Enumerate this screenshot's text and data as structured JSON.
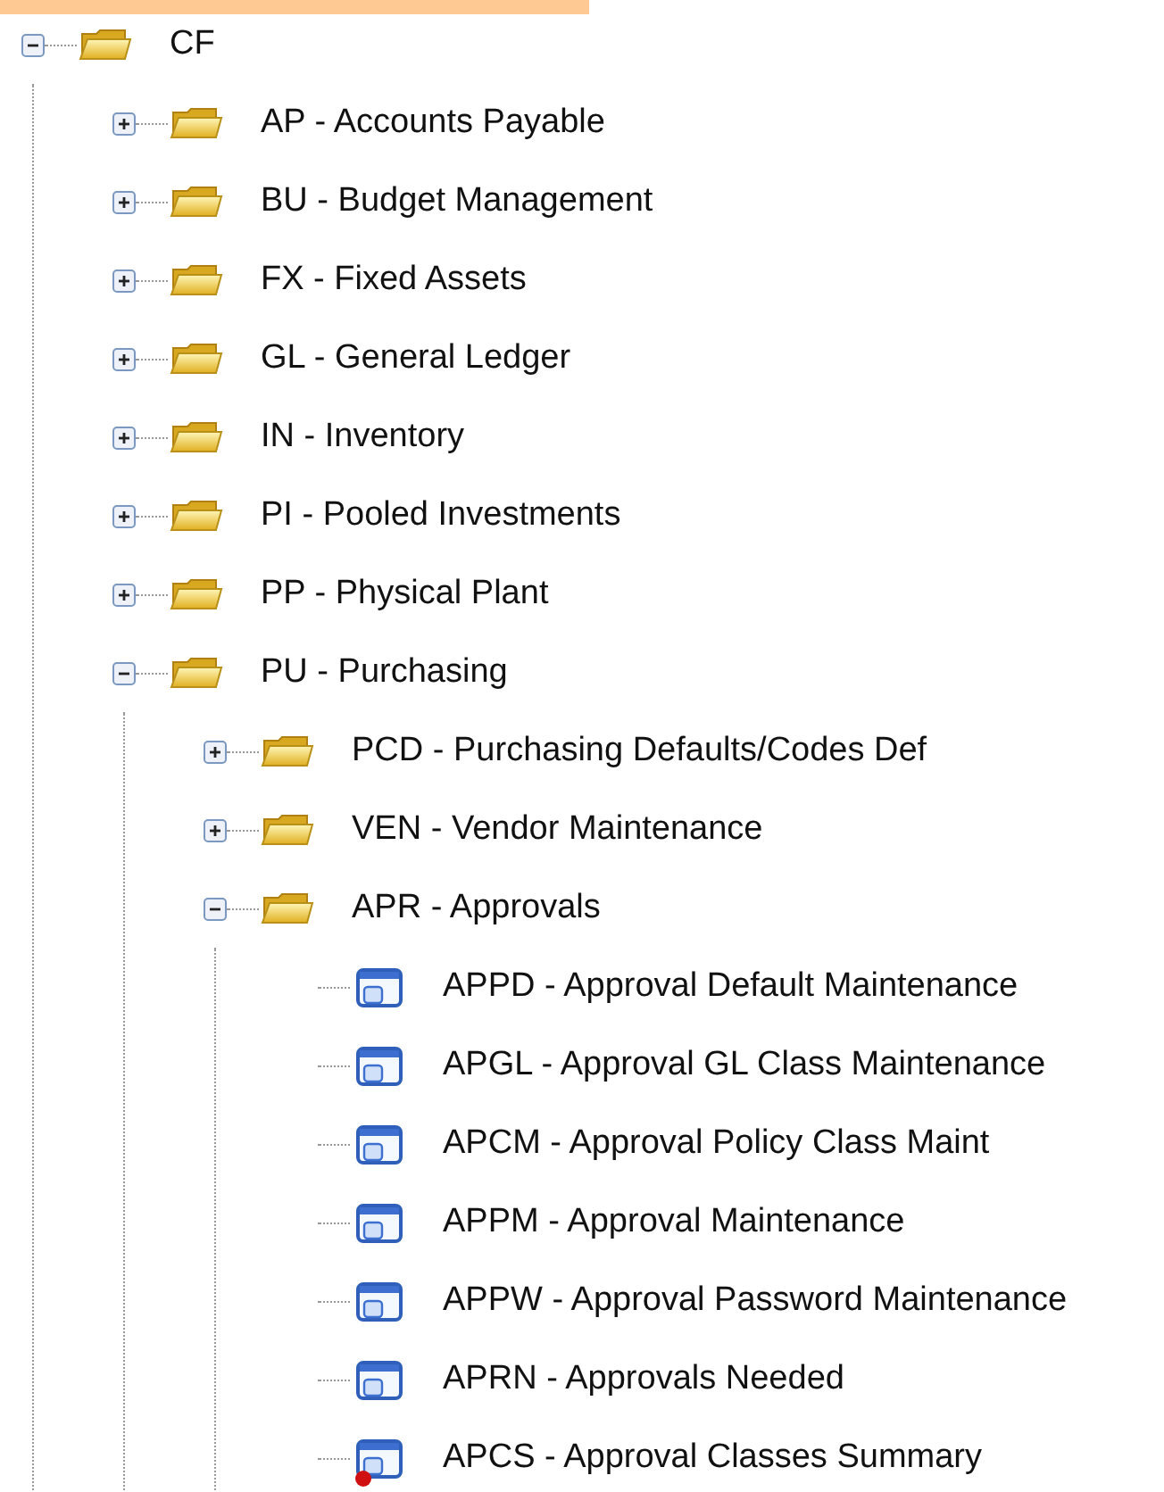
{
  "tree": [
    {
      "kind": "folder",
      "label": "CF",
      "expanded": true,
      "children": [
        {
          "kind": "folder",
          "label": "AP - Accounts Payable",
          "expanded": false
        },
        {
          "kind": "folder",
          "label": "BU - Budget Management",
          "expanded": false
        },
        {
          "kind": "folder",
          "label": "FX - Fixed Assets",
          "expanded": false
        },
        {
          "kind": "folder",
          "label": "GL - General Ledger",
          "expanded": false
        },
        {
          "kind": "folder",
          "label": "IN - Inventory",
          "expanded": false
        },
        {
          "kind": "folder",
          "label": "PI - Pooled Investments",
          "expanded": false
        },
        {
          "kind": "folder",
          "label": "PP - Physical Plant",
          "expanded": false
        },
        {
          "kind": "folder",
          "label": "PU - Purchasing",
          "expanded": true,
          "children": [
            {
              "kind": "folder",
              "label": "PCD - Purchasing Defaults/Codes Def",
              "expanded": false
            },
            {
              "kind": "folder",
              "label": "VEN - Vendor Maintenance",
              "expanded": false
            },
            {
              "kind": "folder",
              "label": "APR - Approvals",
              "expanded": true,
              "children": [
                {
                  "kind": "screen",
                  "label": "APPD - Approval Default Maintenance",
                  "alert": false
                },
                {
                  "kind": "screen",
                  "label": "APGL - Approval GL Class Maintenance",
                  "alert": false
                },
                {
                  "kind": "screen",
                  "label": "APCM - Approval Policy Class Maint",
                  "alert": false
                },
                {
                  "kind": "screen",
                  "label": "APPM - Approval Maintenance",
                  "alert": false
                },
                {
                  "kind": "screen",
                  "label": "APPW - Approval Password Maintenance",
                  "alert": false
                },
                {
                  "kind": "screen",
                  "label": "APRN - Approvals Needed",
                  "alert": false
                },
                {
                  "kind": "screen",
                  "label": "APCS - Approval Classes Summary",
                  "alert": true
                }
              ]
            }
          ]
        }
      ]
    }
  ]
}
